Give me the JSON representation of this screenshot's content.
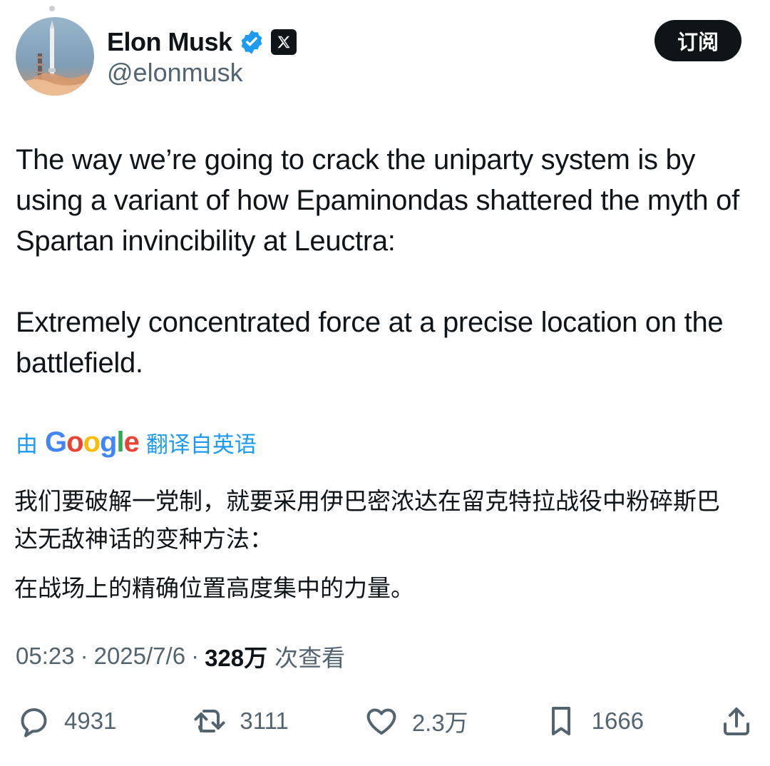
{
  "author": {
    "display_name": "Elon Musk",
    "handle": "@elonmusk",
    "verified_icon": "verified-badge-icon",
    "affiliate_icon": "x-logo-icon"
  },
  "header": {
    "subscribe_label": "订阅"
  },
  "tweet": {
    "paragraphs": [
      "The way we’re going to crack the uniparty system is by using a variant of how Epaminondas shattered the myth of Spartan invincibility at Leuctra:",
      "Extremely concentrated force at a precise location on the battlefield."
    ]
  },
  "translation": {
    "prefix": "由",
    "provider": "Google",
    "suffix": "翻译自英语",
    "paragraphs": [
      "我们要破解一党制，就要采用伊巴密浓达在留克特拉战役中粉碎斯巴达无敌神话的变种方法：",
      "在战场上的精确位置高度集中的力量。"
    ]
  },
  "meta": {
    "time": "05:23",
    "date": "2025/7/6",
    "separator": "·",
    "views_count": "328万",
    "views_label": "次查看"
  },
  "actions": {
    "reply": {
      "icon": "reply-icon",
      "count": "4931"
    },
    "repost": {
      "icon": "repost-icon",
      "count": "3111"
    },
    "like": {
      "icon": "heart-icon",
      "count": "2.3万"
    },
    "bookmark": {
      "icon": "bookmark-icon",
      "count": "1666"
    },
    "share": {
      "icon": "share-icon"
    }
  },
  "colors": {
    "text_primary": "#0f1419",
    "text_secondary": "#536471",
    "accent_blue": "#1d9bf0",
    "button_dark": "#0f1419",
    "background": "#ffffff"
  }
}
